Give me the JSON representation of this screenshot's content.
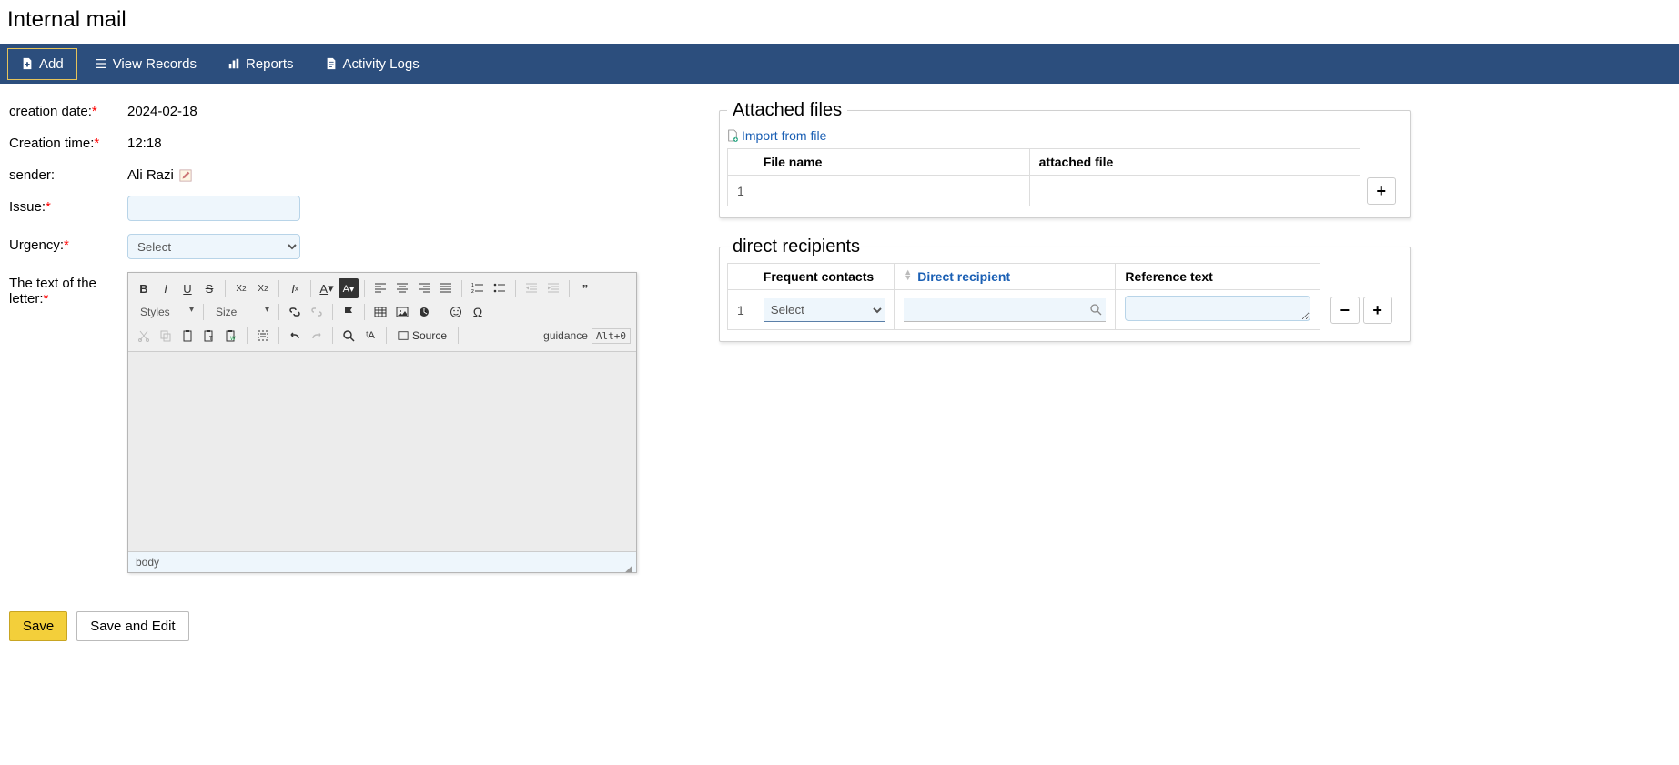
{
  "page_title": "Internal mail",
  "nav": {
    "add": "Add",
    "view_records": "View Records",
    "reports": "Reports",
    "activity_logs": "Activity Logs"
  },
  "form": {
    "creation_date_label": "creation date:",
    "creation_date_value": "2024-02-18",
    "creation_time_label": "Creation time:",
    "creation_time_value": "12:18",
    "sender_label": "sender:",
    "sender_value": "Ali Razi",
    "issue_label": "Issue:",
    "urgency_label": "Urgency:",
    "urgency_value": "Select",
    "letter_text_label_line1": "The text of the",
    "letter_text_label_line2": "letter:"
  },
  "editor": {
    "styles_label": "Styles",
    "size_label": "Size",
    "source_label": "Source",
    "guidance_label": "guidance",
    "guidance_key": "Alt+0",
    "footer_path": "body"
  },
  "attached": {
    "legend": "Attached files",
    "import_link": "Import from file",
    "col_filename": "File name",
    "col_attached": "attached file",
    "row1_num": "1"
  },
  "recipients": {
    "legend": "direct recipients",
    "col_frequent": "Frequent contacts",
    "col_direct": "Direct recipient",
    "col_reference": "Reference text",
    "row1_num": "1",
    "row1_select": "Select"
  },
  "actions": {
    "save": "Save",
    "save_edit": "Save and Edit"
  }
}
